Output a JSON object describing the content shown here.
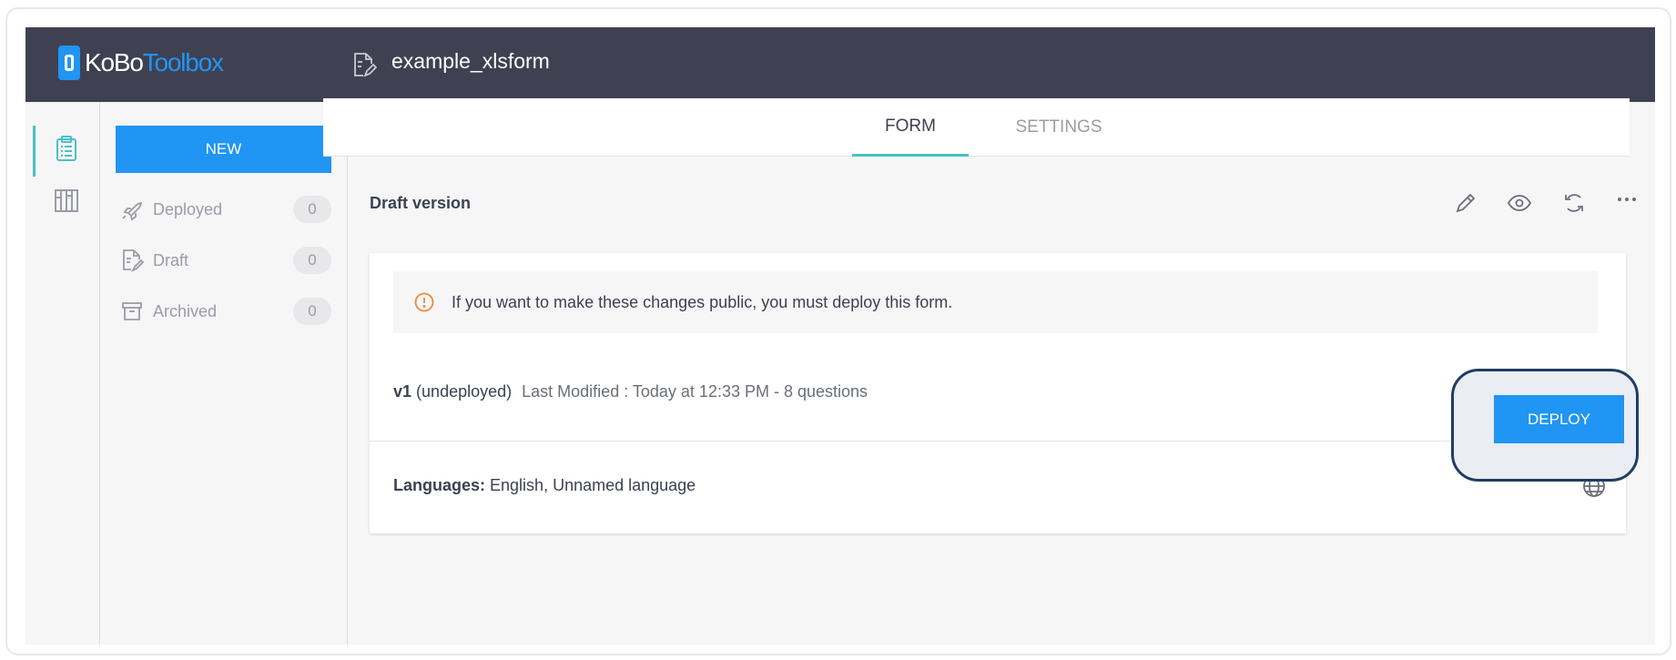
{
  "header": {
    "logo": {
      "kobo": "KoBo",
      "toolbox": "Toolbox"
    },
    "asset_icon": "form-draft-icon",
    "asset_title": "example_xlsform"
  },
  "rail": {
    "items": [
      {
        "name": "forms",
        "icon": "clipboard-icon",
        "active": true
      },
      {
        "name": "library",
        "icon": "library-icon",
        "active": false
      }
    ]
  },
  "sidebar": {
    "new_label": "NEW",
    "items": [
      {
        "label": "Deployed",
        "count": "0",
        "icon": "rocket-icon"
      },
      {
        "label": "Draft",
        "count": "0",
        "icon": "draft-icon"
      },
      {
        "label": "Archived",
        "count": "0",
        "icon": "archive-icon"
      }
    ]
  },
  "tabs": [
    {
      "label": "FORM",
      "active": true
    },
    {
      "label": "SETTINGS",
      "active": false
    }
  ],
  "main": {
    "section_title": "Draft version",
    "toolbar_icons": [
      "edit-icon",
      "preview-icon",
      "replace-icon",
      "more-icon"
    ],
    "alert": "If you want to make these changes public, you must deploy this form.",
    "version": {
      "number": "v1",
      "state": "(undeployed)",
      "meta": "Last Modified : Today at 12:33 PM - 8 questions"
    },
    "deploy_label": "DEPLOY",
    "languages_label": "Languages:",
    "languages_value": "English, Unnamed language",
    "languages_icon": "globe-icon"
  },
  "colors": {
    "header_bg": "#3f4152",
    "primary": "#2095f3",
    "accent_teal": "#4bbfc6",
    "alert_icon": "#f0883a",
    "highlight_border": "#1f3d63"
  }
}
